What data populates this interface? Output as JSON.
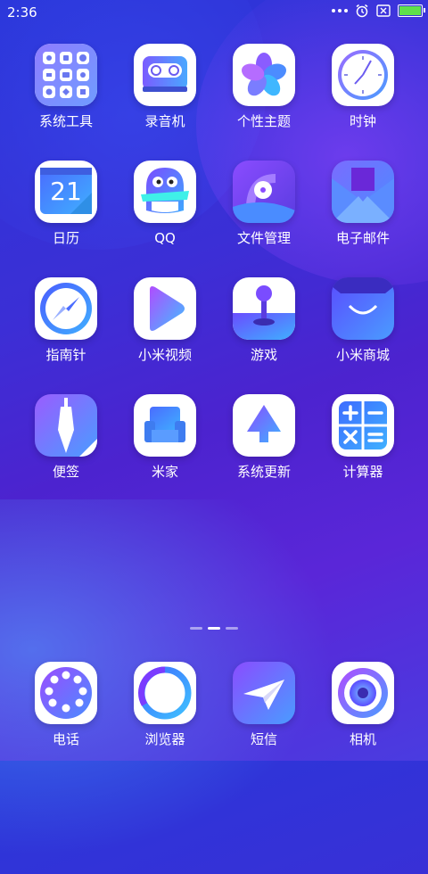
{
  "status_bar": {
    "time": "2:36"
  },
  "apps": [
    {
      "label": "系统工具"
    },
    {
      "label": "录音机"
    },
    {
      "label": "个性主题"
    },
    {
      "label": "时钟"
    },
    {
      "label": "日历",
      "calendar_day": "21"
    },
    {
      "label": "QQ"
    },
    {
      "label": "文件管理"
    },
    {
      "label": "电子邮件"
    },
    {
      "label": "指南针"
    },
    {
      "label": "小米视频"
    },
    {
      "label": "游戏"
    },
    {
      "label": "小米商城"
    },
    {
      "label": "便签"
    },
    {
      "label": "米家"
    },
    {
      "label": "系统更新"
    },
    {
      "label": "计算器"
    }
  ],
  "dock": [
    {
      "label": "电话"
    },
    {
      "label": "浏览器"
    },
    {
      "label": "短信"
    },
    {
      "label": "相机"
    }
  ],
  "page_indicator": {
    "pages": 3,
    "active_page": 2
  }
}
